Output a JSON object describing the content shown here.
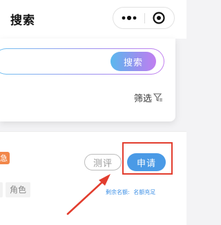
{
  "header": {
    "title": "搜索",
    "more_icon": "more-dots-icon",
    "close_icon": "target-close-icon"
  },
  "search": {
    "value": "",
    "placeholder": "",
    "button_label": "搜索",
    "filter_label": "筛选",
    "filter_icon": "filter-icon"
  },
  "result": {
    "orange_tag_text": "急",
    "eval_label": "测评",
    "apply_label": "申请",
    "tags": [
      "",
      "角色"
    ],
    "quota_label": "剩余名额:",
    "quota_value": "名额充足"
  },
  "colors": {
    "accent_blue": "#4a9ae6",
    "gradient_start": "#5ab8ee",
    "gradient_end": "#c07ff0",
    "highlight_red": "#e23d2e",
    "orange_tag": "#f2874a"
  }
}
